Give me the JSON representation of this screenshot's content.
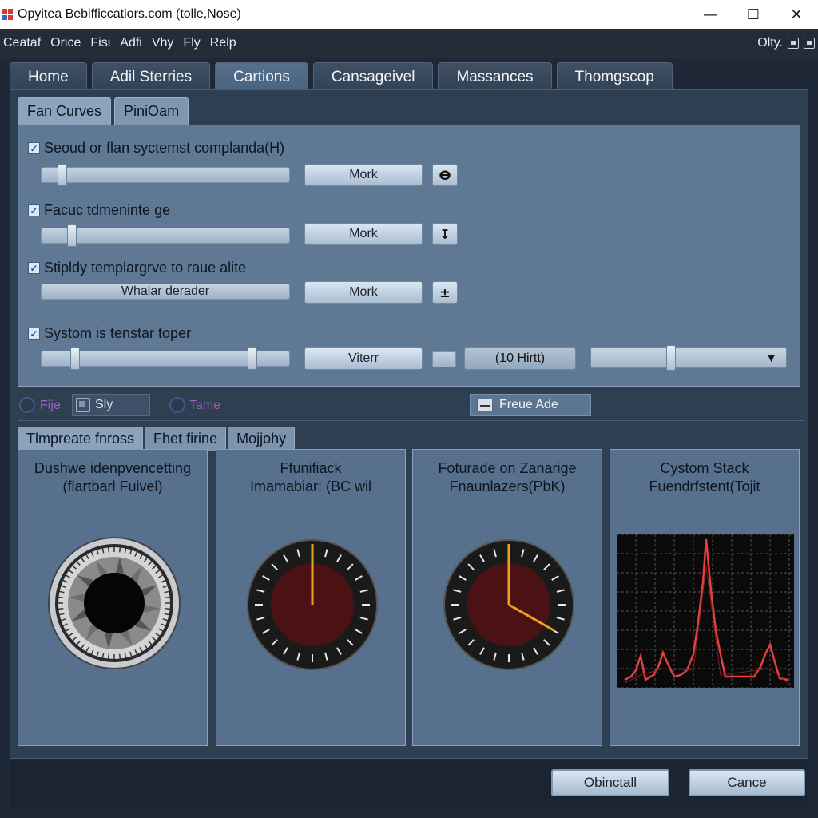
{
  "window": {
    "title": "Opyitea Bebifficcatiors.com (tolle,Nose)",
    "controls": {
      "minimize": "—",
      "maximize": "☐",
      "close": "✕"
    }
  },
  "menu": {
    "items": [
      "Ceataf",
      "Orice",
      "Fisi",
      "Adfi",
      "Vhy",
      "Fly",
      "Relp"
    ],
    "right_label": "Olty."
  },
  "main_tabs": [
    "Home",
    "Adil Sterries",
    "Cartions",
    "Cansageivel",
    "Massances",
    "Thomgscop"
  ],
  "fan_tabs": [
    "Fan Curves",
    "PiniOam"
  ],
  "fan_rows": [
    {
      "label": "Seoud or flan syctemst complanda(H)",
      "checked": true,
      "slider_level": 0.08,
      "button": "Mork",
      "icon": "ⴱ",
      "icon_name": "lock-icon"
    },
    {
      "label": "Facuc tdmeninte ge",
      "checked": true,
      "slider_level": 0.12,
      "button": "Mork",
      "icon": "↧",
      "icon_name": "download-icon"
    },
    {
      "label": "Stipldy templargrve to raue alite",
      "checked": true,
      "slider_text": "Whalar derader",
      "button": "Mork",
      "icon": "±",
      "icon_name": "plus-minus-icon"
    },
    {
      "label": "Systom is tenstar toper",
      "checked": true,
      "button": "Viterr",
      "field": "(10 Hirtt)"
    }
  ],
  "options": {
    "radio1": "Fije",
    "toggle": "Sly",
    "radio2": "Tame",
    "action": "Freue Ade"
  },
  "monitor_tabs": [
    "Tlmpreate fnross",
    "Fhet firine",
    "Mojjohy"
  ],
  "cards": [
    {
      "title_line1": "Dushwe idenpvencetting",
      "title_line2": "(flartbarl Fuivel)",
      "visual": "fan-gauge-icon"
    },
    {
      "title_line1": "Ffunifiack",
      "title_line2": "Imamabiar: (BC wil",
      "visual": "temperature-dial-icon"
    },
    {
      "title_line1": "Foturade on Zanarige",
      "title_line2": "Fnaunlazers(PbK)",
      "visual": "speed-dial-icon"
    },
    {
      "title_line1": "Cystom Stack",
      "title_line2": "Fuendrfstent(Tojit",
      "visual": "waveform-chart"
    }
  ],
  "footer": {
    "primary": "Obinctall",
    "cancel": "Cance"
  },
  "colors": {
    "accent_needle": "#f0a020",
    "waveform": "#e04040",
    "panel": "#5f7893"
  }
}
